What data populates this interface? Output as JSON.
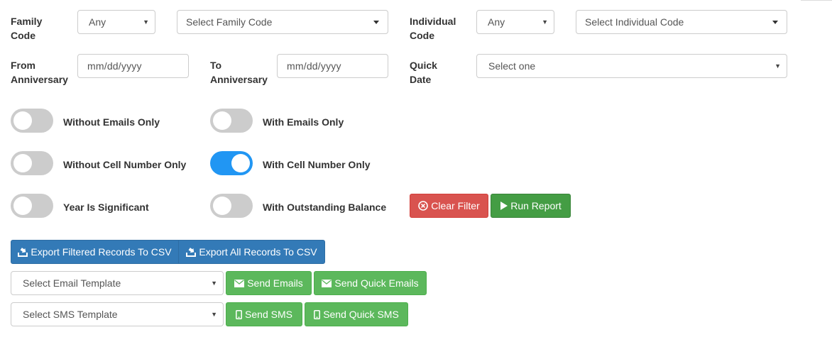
{
  "filters": {
    "family_code_label_1": "Family",
    "family_code_label_2": "Code",
    "family_any": "Any",
    "family_code_placeholder": "Select Family Code",
    "individual_code_label_1": "Individual",
    "individual_code_label_2": "Code",
    "individual_any": "Any",
    "individual_code_placeholder": "Select Individual Code",
    "from_anniversary_label_1": "From",
    "from_anniversary_label_2": "Anniversary",
    "from_anniversary_placeholder": "mm/dd/yyyy",
    "to_anniversary_label_1": "To",
    "to_anniversary_label_2": "Anniversary",
    "to_anniversary_placeholder": "mm/dd/yyyy",
    "quick_date_label_1": "Quick",
    "quick_date_label_2": "Date",
    "quick_date_value": "Select one"
  },
  "toggles": {
    "without_emails": {
      "label": "Without Emails Only",
      "on": false
    },
    "with_emails": {
      "label": "With Emails Only",
      "on": false
    },
    "without_cell": {
      "label": "Without Cell Number Only",
      "on": false
    },
    "with_cell": {
      "label": "With Cell Number Only",
      "on": true
    },
    "year_significant": {
      "label": "Year Is Significant",
      "on": false
    },
    "outstanding_balance": {
      "label": "With Outstanding Balance",
      "on": false
    }
  },
  "actions": {
    "clear_filter": "Clear Filter",
    "run_report": "Run Report",
    "export_filtered": "Export Filtered Records To CSV",
    "export_all": "Export All Records To CSV",
    "email_template_placeholder": "Select Email Template",
    "send_emails": "Send Emails",
    "send_quick_emails": "Send Quick Emails",
    "sms_template_placeholder": "Select SMS Template",
    "send_sms": "Send SMS",
    "send_quick_sms": "Send Quick SMS"
  },
  "colors": {
    "toggle_on": "#2196f3",
    "toggle_off": "#cccccc",
    "danger": "#d9534f",
    "success": "#449d44",
    "success_light": "#5cb85c",
    "primary": "#337ab7"
  }
}
